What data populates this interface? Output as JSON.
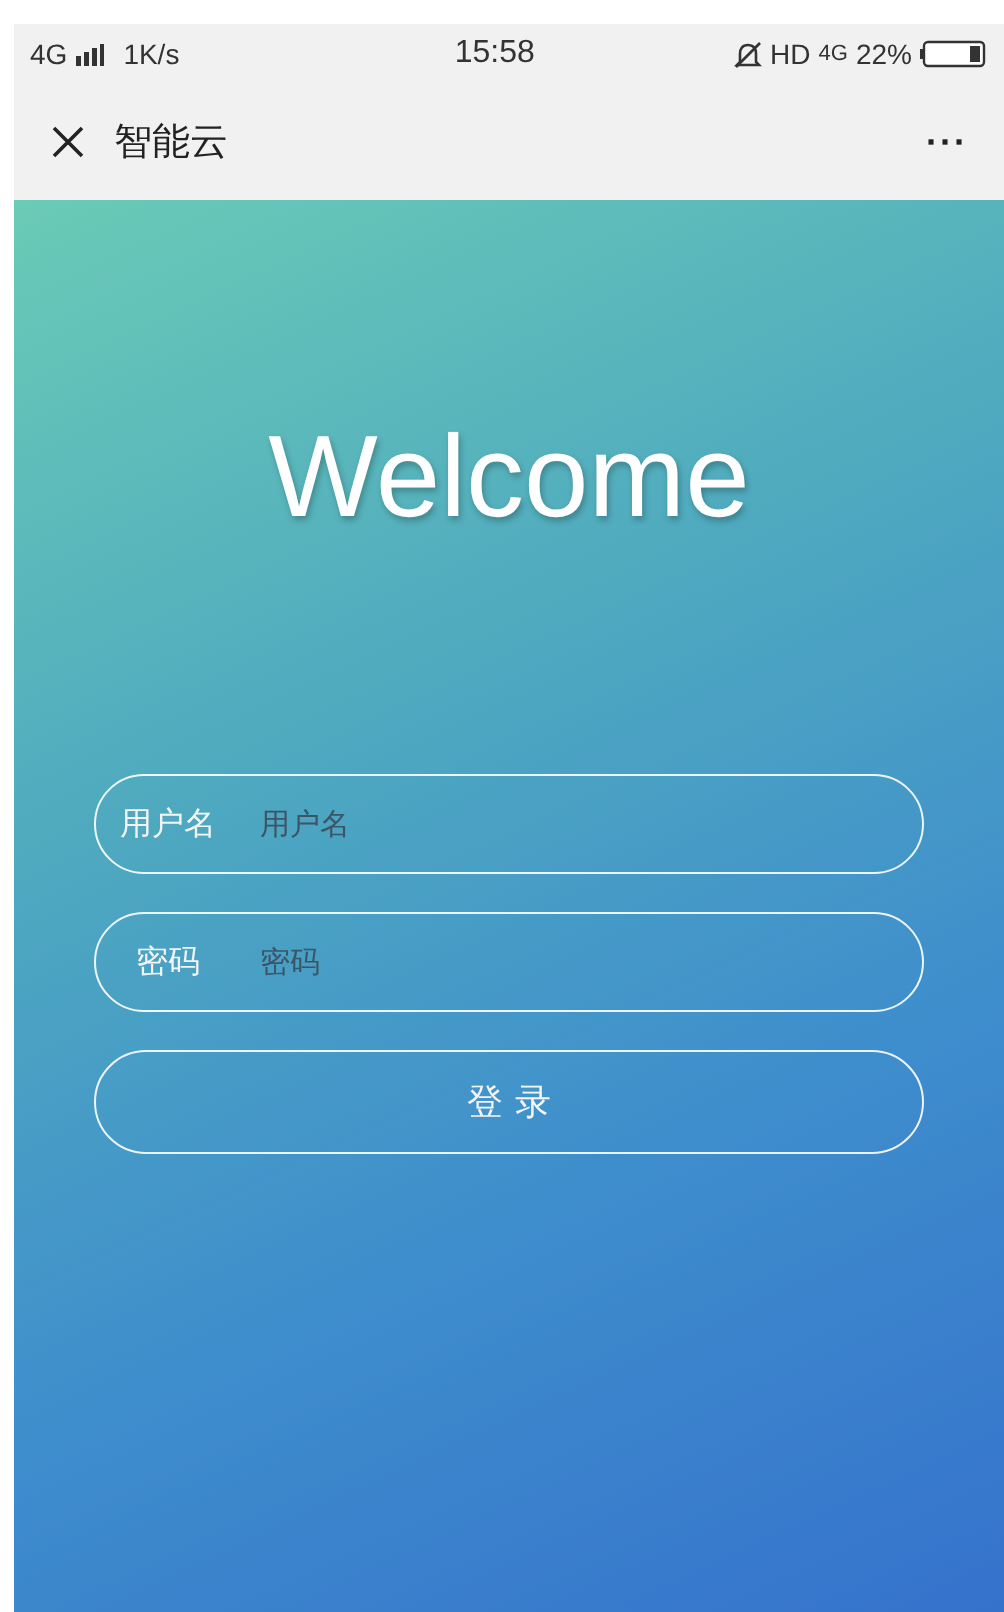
{
  "status_bar": {
    "network": "4G",
    "speed": "1K/s",
    "time": "15:58",
    "hd": "HD",
    "data_network": "4G",
    "battery": "22%"
  },
  "nav_bar": {
    "title": "智能云",
    "menu": "···"
  },
  "welcome": "Welcome",
  "fields": [
    {
      "label": "用户名",
      "placeholder": "用户名",
      "kind": "text"
    },
    {
      "label": "密码",
      "placeholder": "密码",
      "kind": "password"
    }
  ],
  "login_button": "登 录"
}
